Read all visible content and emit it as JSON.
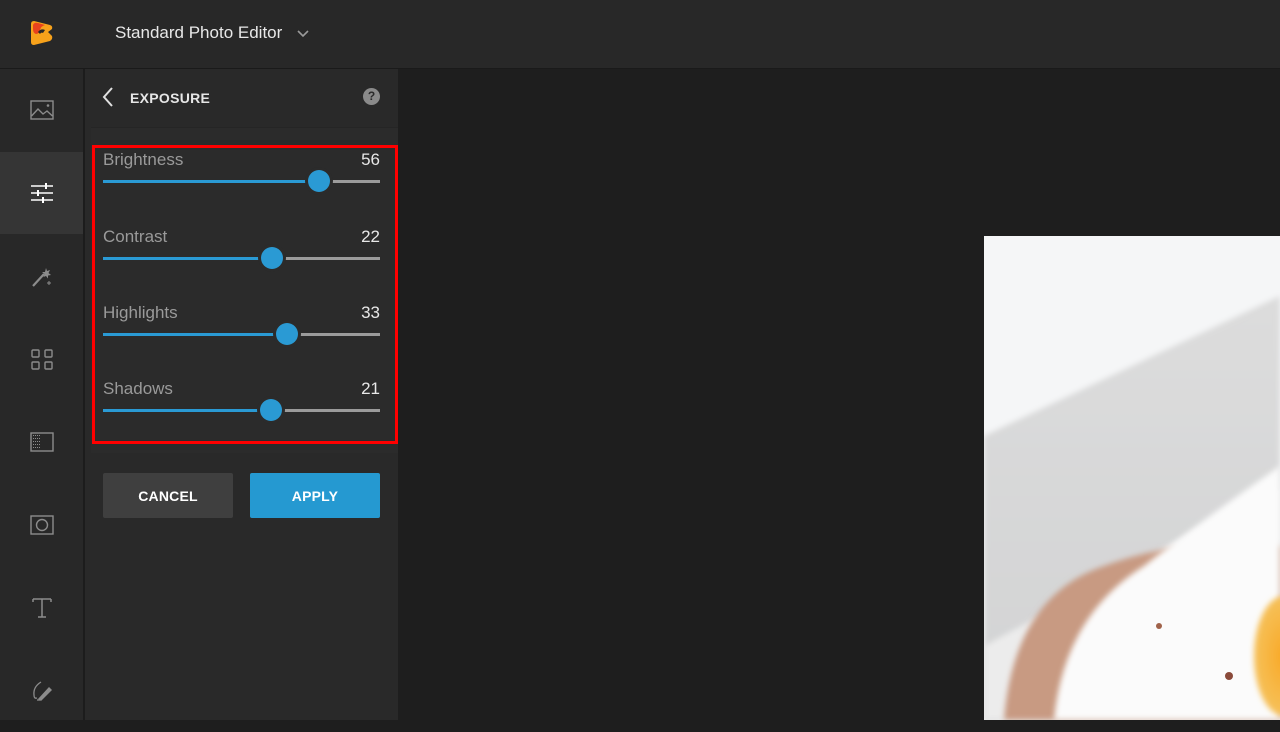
{
  "app": {
    "title": "Standard Photo Editor",
    "logo_icon": "app-logo-icon",
    "title_dropdown_icon": "chevron-down-icon"
  },
  "colors": {
    "accent": "#2a9ad4",
    "apply_button": "#2599d1",
    "highlight_box": "#ff0000",
    "logo_orange": "#f7a21b",
    "logo_red": "#e8431d"
  },
  "sidebar": {
    "items": [
      {
        "id": "image",
        "icon": "image-icon",
        "active": false
      },
      {
        "id": "adjust",
        "icon": "sliders-icon",
        "active": true
      },
      {
        "id": "effects",
        "icon": "magic-wand-icon",
        "active": false
      },
      {
        "id": "layouts",
        "icon": "grid-icon",
        "active": false
      },
      {
        "id": "texture",
        "icon": "texture-icon",
        "active": false
      },
      {
        "id": "frames",
        "icon": "frame-icon",
        "active": false
      },
      {
        "id": "text",
        "icon": "text-icon",
        "active": false
      },
      {
        "id": "draw",
        "icon": "brush-icon",
        "active": false
      }
    ]
  },
  "panel": {
    "title": "EXPOSURE",
    "back_icon": "chevron-left-icon",
    "help_icon": "help-icon",
    "help_glyph": "?",
    "slider_range": [
      -100,
      100
    ],
    "sliders": [
      {
        "label": "Brightness",
        "value": 56
      },
      {
        "label": "Contrast",
        "value": 22
      },
      {
        "label": "Highlights",
        "value": 33
      },
      {
        "label": "Shadows",
        "value": 21
      }
    ],
    "cancel_label": "CANCEL",
    "apply_label": "APPLY"
  },
  "canvas": {
    "photo_subject": "fried egg on toast (partially visible)"
  }
}
